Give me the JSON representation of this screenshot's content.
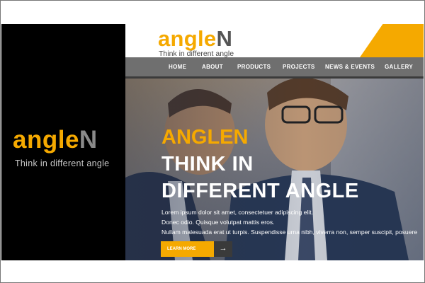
{
  "brand": {
    "logo_part1": "angle",
    "logo_part2": "N",
    "tagline": "Think in different angle"
  },
  "site": {
    "logo_part1": "angle",
    "logo_part2": "N",
    "tagline": "Think in different angle",
    "nav": [
      "HOME",
      "ABOUT",
      "PRODUCTS",
      "PROJECTS",
      "NEWS & EVENTS",
      "GALLERY"
    ],
    "hero": {
      "title_line1": "ANGLEN",
      "title_line2": "THINK IN",
      "title_line3": "DIFFERENT ANGLE",
      "text_line1": "Lorem ipsum dolor sit amet, consectetuer adipiscing elit.",
      "text_line2": "Donec odio. Quisque volutpat mattis eros.",
      "text_line3": "Nullam malesuada erat ut turpis. Suspendisse urna nibh, viverra non, semper suscipit, posuere",
      "button_label": "LEARN MORE",
      "button_arrow": "→"
    }
  },
  "colors": {
    "accent": "#f5a900",
    "nav_bg": "#6f6f6f",
    "panel_bg": "#000000"
  }
}
